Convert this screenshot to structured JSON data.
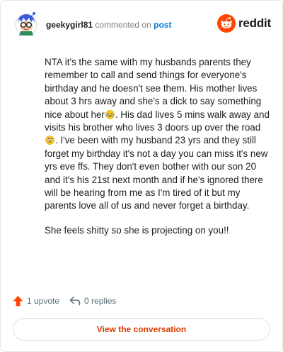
{
  "header": {
    "username": "geekygirl81",
    "commented_text": "commented on",
    "post_link": "post",
    "brand": "reddit"
  },
  "comment": {
    "paragraph1_part1": "NTA it's the same with my husbands parents they remember to call and send things for everyone's birthday and he doesn't see them. His mother lives about 3 hrs away and she's a dick to say something nice about her",
    "paragraph1_part2": ". His dad lives 5 mins walk away and visits his brother who lives 3 doors up over the road",
    "paragraph1_part3": ". I've been with my husband 23 yrs and they still forget my birthday it's not a day you can miss it's new yrs eve ffs. They don't even bother with our son 20 and it's his 21st next month and if he's ignored there will be hearing from me as I'm tired of it but my parents love all of us and never forget a birthday.",
    "paragraph2": "She feels shitty so she is projecting on you!!",
    "emoji1": "laughing-crying-emoji",
    "emoji2": "rolling-eyes-emoji"
  },
  "actions": {
    "upvote_label": "1 upvote",
    "replies_label": "0 replies"
  },
  "footer": {
    "view_button": "View the conversation"
  },
  "colors": {
    "brand_orange": "#ff4500",
    "upvote": "#ff4500",
    "link_blue": "#0079d3",
    "button_text": "#d93a00"
  }
}
